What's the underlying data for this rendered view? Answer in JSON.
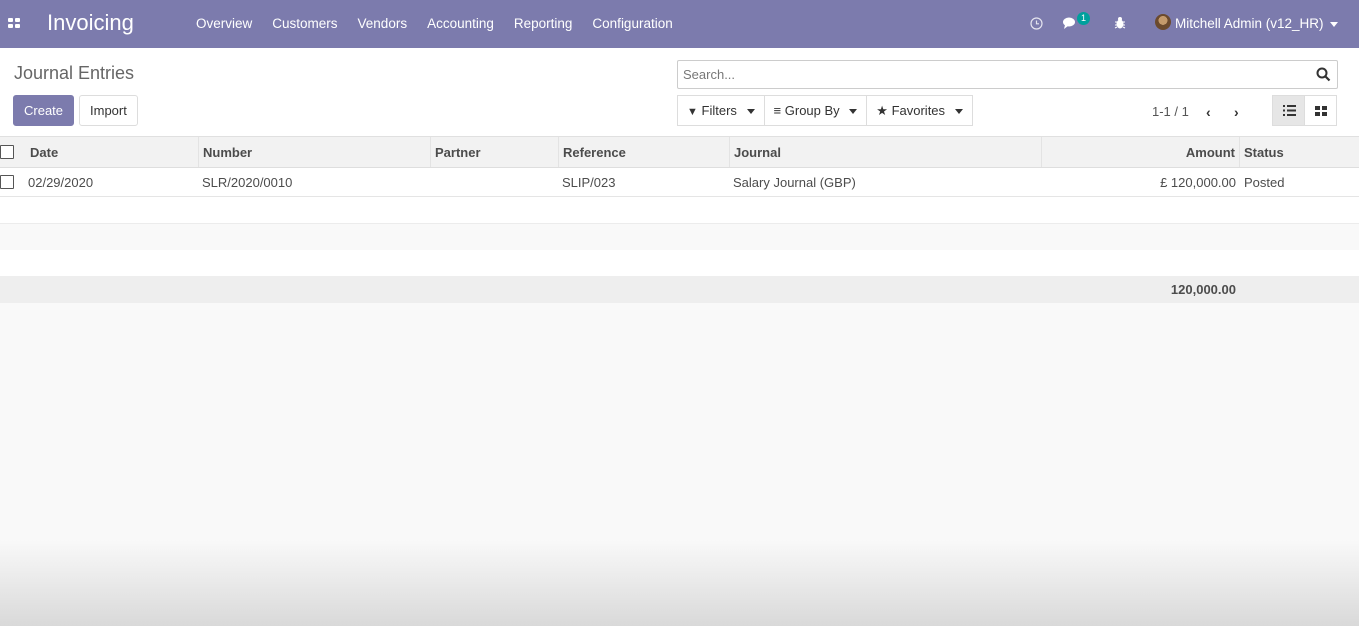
{
  "navbar": {
    "app_title": "Invoicing",
    "menu": [
      "Overview",
      "Customers",
      "Vendors",
      "Accounting",
      "Reporting",
      "Configuration"
    ],
    "messages_count": "1",
    "user": "Mitchell Admin (v12_HR)"
  },
  "control": {
    "breadcrumb": "Journal Entries",
    "create_label": "Create",
    "import_label": "Import",
    "search_placeholder": "Search...",
    "filters_label": "Filters",
    "groupby_label": "Group By",
    "favorites_label": "Favorites",
    "pager": "1-1 / 1"
  },
  "table": {
    "columns": [
      "Date",
      "Number",
      "Partner",
      "Reference",
      "Journal",
      "Amount",
      "Status"
    ],
    "rows": [
      {
        "date": "02/29/2020",
        "number": "SLR/2020/0010",
        "partner": "",
        "reference": "SLIP/023",
        "journal": "Salary Journal (GBP)",
        "amount": "£ 120,000.00",
        "status": "Posted"
      }
    ],
    "total": "120,000.00"
  },
  "colors": {
    "brand": "#7c7bad",
    "badge": "#00a09d"
  }
}
